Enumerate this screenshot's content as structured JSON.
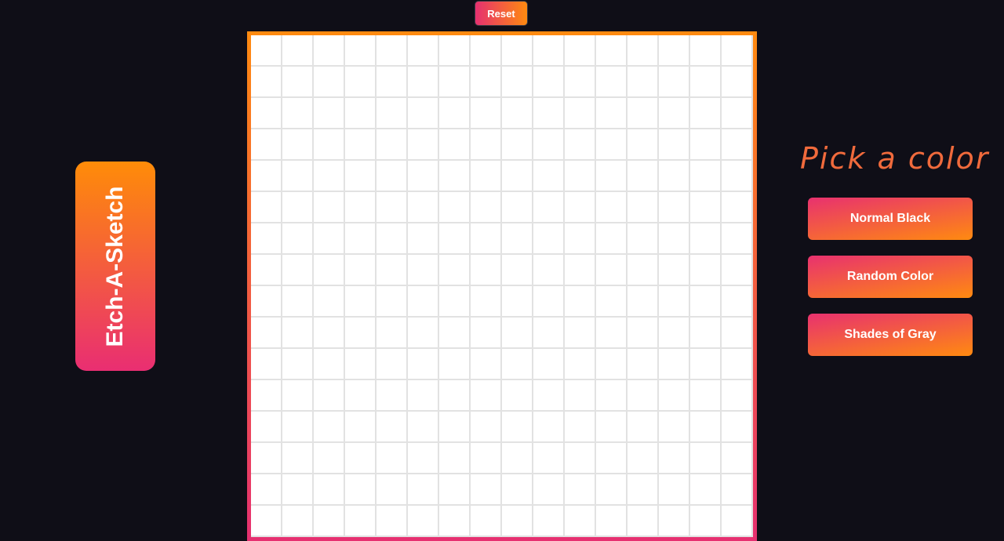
{
  "toolbar": {
    "reset_label": "Reset"
  },
  "title": {
    "text": "Etch-A-Sketch"
  },
  "grid": {
    "rows": 16,
    "cols": 16,
    "cell_color": "#ffffff",
    "line_color": "#e2e2e2"
  },
  "palette": {
    "heading": "Pick a color",
    "buttons": [
      {
        "label": "Normal Black"
      },
      {
        "label": "Random Color"
      },
      {
        "label": "Shades of Gray"
      }
    ]
  },
  "colors": {
    "background": "#0f0e17",
    "accent_orange": "#ff8a10",
    "accent_pink": "#e63070",
    "heading": "#f06a3c"
  }
}
